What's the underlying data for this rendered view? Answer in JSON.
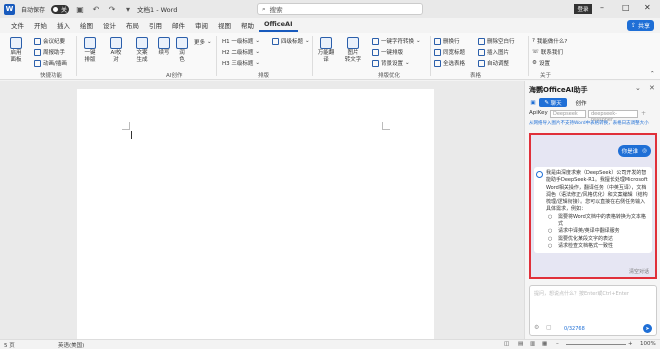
{
  "titlebar": {
    "app_icon": "W",
    "autosave_label": "自动保存",
    "autosave_state": "关",
    "doc_title": "文档1 - Word",
    "search_placeholder": "搜索",
    "login_label": "登录",
    "minimize": "–",
    "maximize": "□",
    "close": "✕",
    "icons": [
      "save-icon",
      "undo-icon",
      "redo-icon",
      "customize-icon"
    ]
  },
  "menu": {
    "tabs": [
      "文件",
      "开始",
      "插入",
      "绘图",
      "设计",
      "布局",
      "引用",
      "邮件",
      "审阅",
      "视图",
      "帮助",
      "OfficeAI"
    ],
    "active": "OfficeAI",
    "share_label": "共享"
  },
  "ribbon": {
    "btn_qidong": "启用\n面板",
    "btn_huiyi": "会议纪要",
    "btn_zhouli": "周报助手",
    "btn_donghua": "动画/插画",
    "group_quick": "快捷功能",
    "btn_yijian": "一键\n排版",
    "btn_aicx": "AI校\n对",
    "btn_wenchuang": "文案\n生成",
    "btn_xiexu": "续写",
    "btn_rowei": "润\n色",
    "btn_more": "更多",
    "group_ai": "AI创作",
    "h1": "H1 一级标题",
    "h2": "H2 二级标题",
    "h3": "H3 三级标题",
    "h4": "四级标题",
    "group_paiban": "排版",
    "btn_wanneng": "万能翻\n译",
    "btn_tupian": "图片\n转文字",
    "btn_zifu": "一键字符转换",
    "btn_yijianpaiban": "一键排版",
    "btn_beijing": "背景设置",
    "group_youhua": "排版优化",
    "btn_huanhang": "删换行",
    "btn_tongyi": "同宽标题",
    "btn_quanxuan": "全选表格",
    "btn_chaxun": "删除空白行",
    "btn_yihuan": "插入图片",
    "btn_shanchu": "删除空行",
    "btn_zidong": "自动调整",
    "group_biaoge": "表格",
    "btn_wojiao": "我能做什么?",
    "btn_lianxi": "联系我们",
    "btn_shezhi": "设置",
    "group_guanyu": "关于"
  },
  "statusbar": {
    "page": "第 1 页，共 1 页",
    "words": "5 页",
    "language": "英语(美国)",
    "zoom": "100%"
  },
  "panel": {
    "title": "海鹦OfficeAI助手",
    "tab_chat": "聊天",
    "tab_create": "创作",
    "apikey_label": "ApiKey",
    "apikey_value": "Deepseek",
    "model_value": "deepseek-reasoner",
    "notice": "从网络导入图片不支持Word中表格转换，表格日志调整大小",
    "user_msg": "你是谁",
    "bot_intro": "我是由深度求索（DeepSeek）公司开发的智能助手DeepSeek-R1。我擅长处理Microsoft Word相关操作，翻译任务（中英互译），文档润色（语法修正/风格优化）和文案编辑（结构梳理/逻辑衔接）。您可以直接在右侧任务输入具体需求，例如：",
    "bot_items": [
      "需要将Word文档中的表格转换为文本格式",
      "请求中译英/英译中翻译服务",
      "需要优化某段文字的表达",
      "请求检查文档格式一致性"
    ],
    "clear_label": "清空对话",
    "input_placeholder": "提问，想说点什么？按Enter或Ctrl+Enter",
    "counter": "0/32768"
  }
}
